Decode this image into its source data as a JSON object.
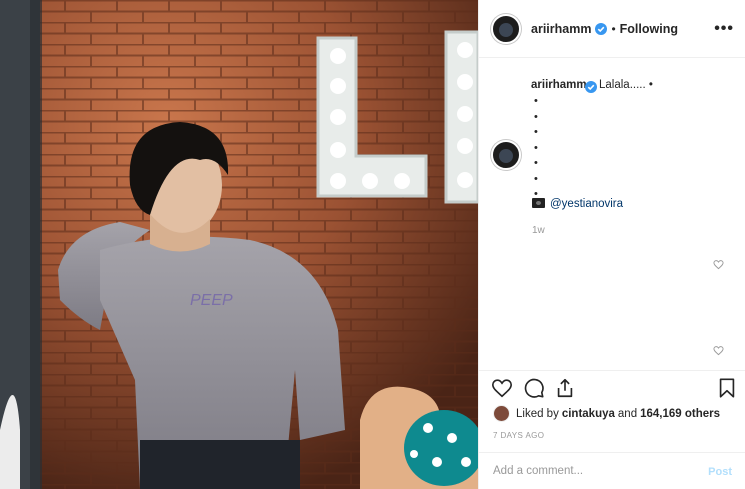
{
  "post": {
    "image_alt": "Person in grey sweater leaning against brick wall with marquee letters",
    "header": {
      "username": "ariirhamm",
      "separator": "•",
      "follow_label": "Following",
      "more_label": "•••"
    },
    "caption": {
      "username": "ariirhamm",
      "text": "Lalala..... •",
      "bullets": [
        "•",
        "•",
        "•",
        "•",
        "•",
        "•",
        "•"
      ],
      "tag": "@yestianovira",
      "age": "1w"
    },
    "likes": {
      "prefix": "Liked by",
      "user": "cintakuya",
      "middle": "and",
      "count": "164,169 others"
    },
    "date": "7 DAYS AGO",
    "comment_box": {
      "placeholder": "Add a comment...",
      "post_label": "Post"
    }
  },
  "colors": {
    "verified": "#3897f0",
    "link": "#003569",
    "post_disabled": "#b2dffc"
  }
}
